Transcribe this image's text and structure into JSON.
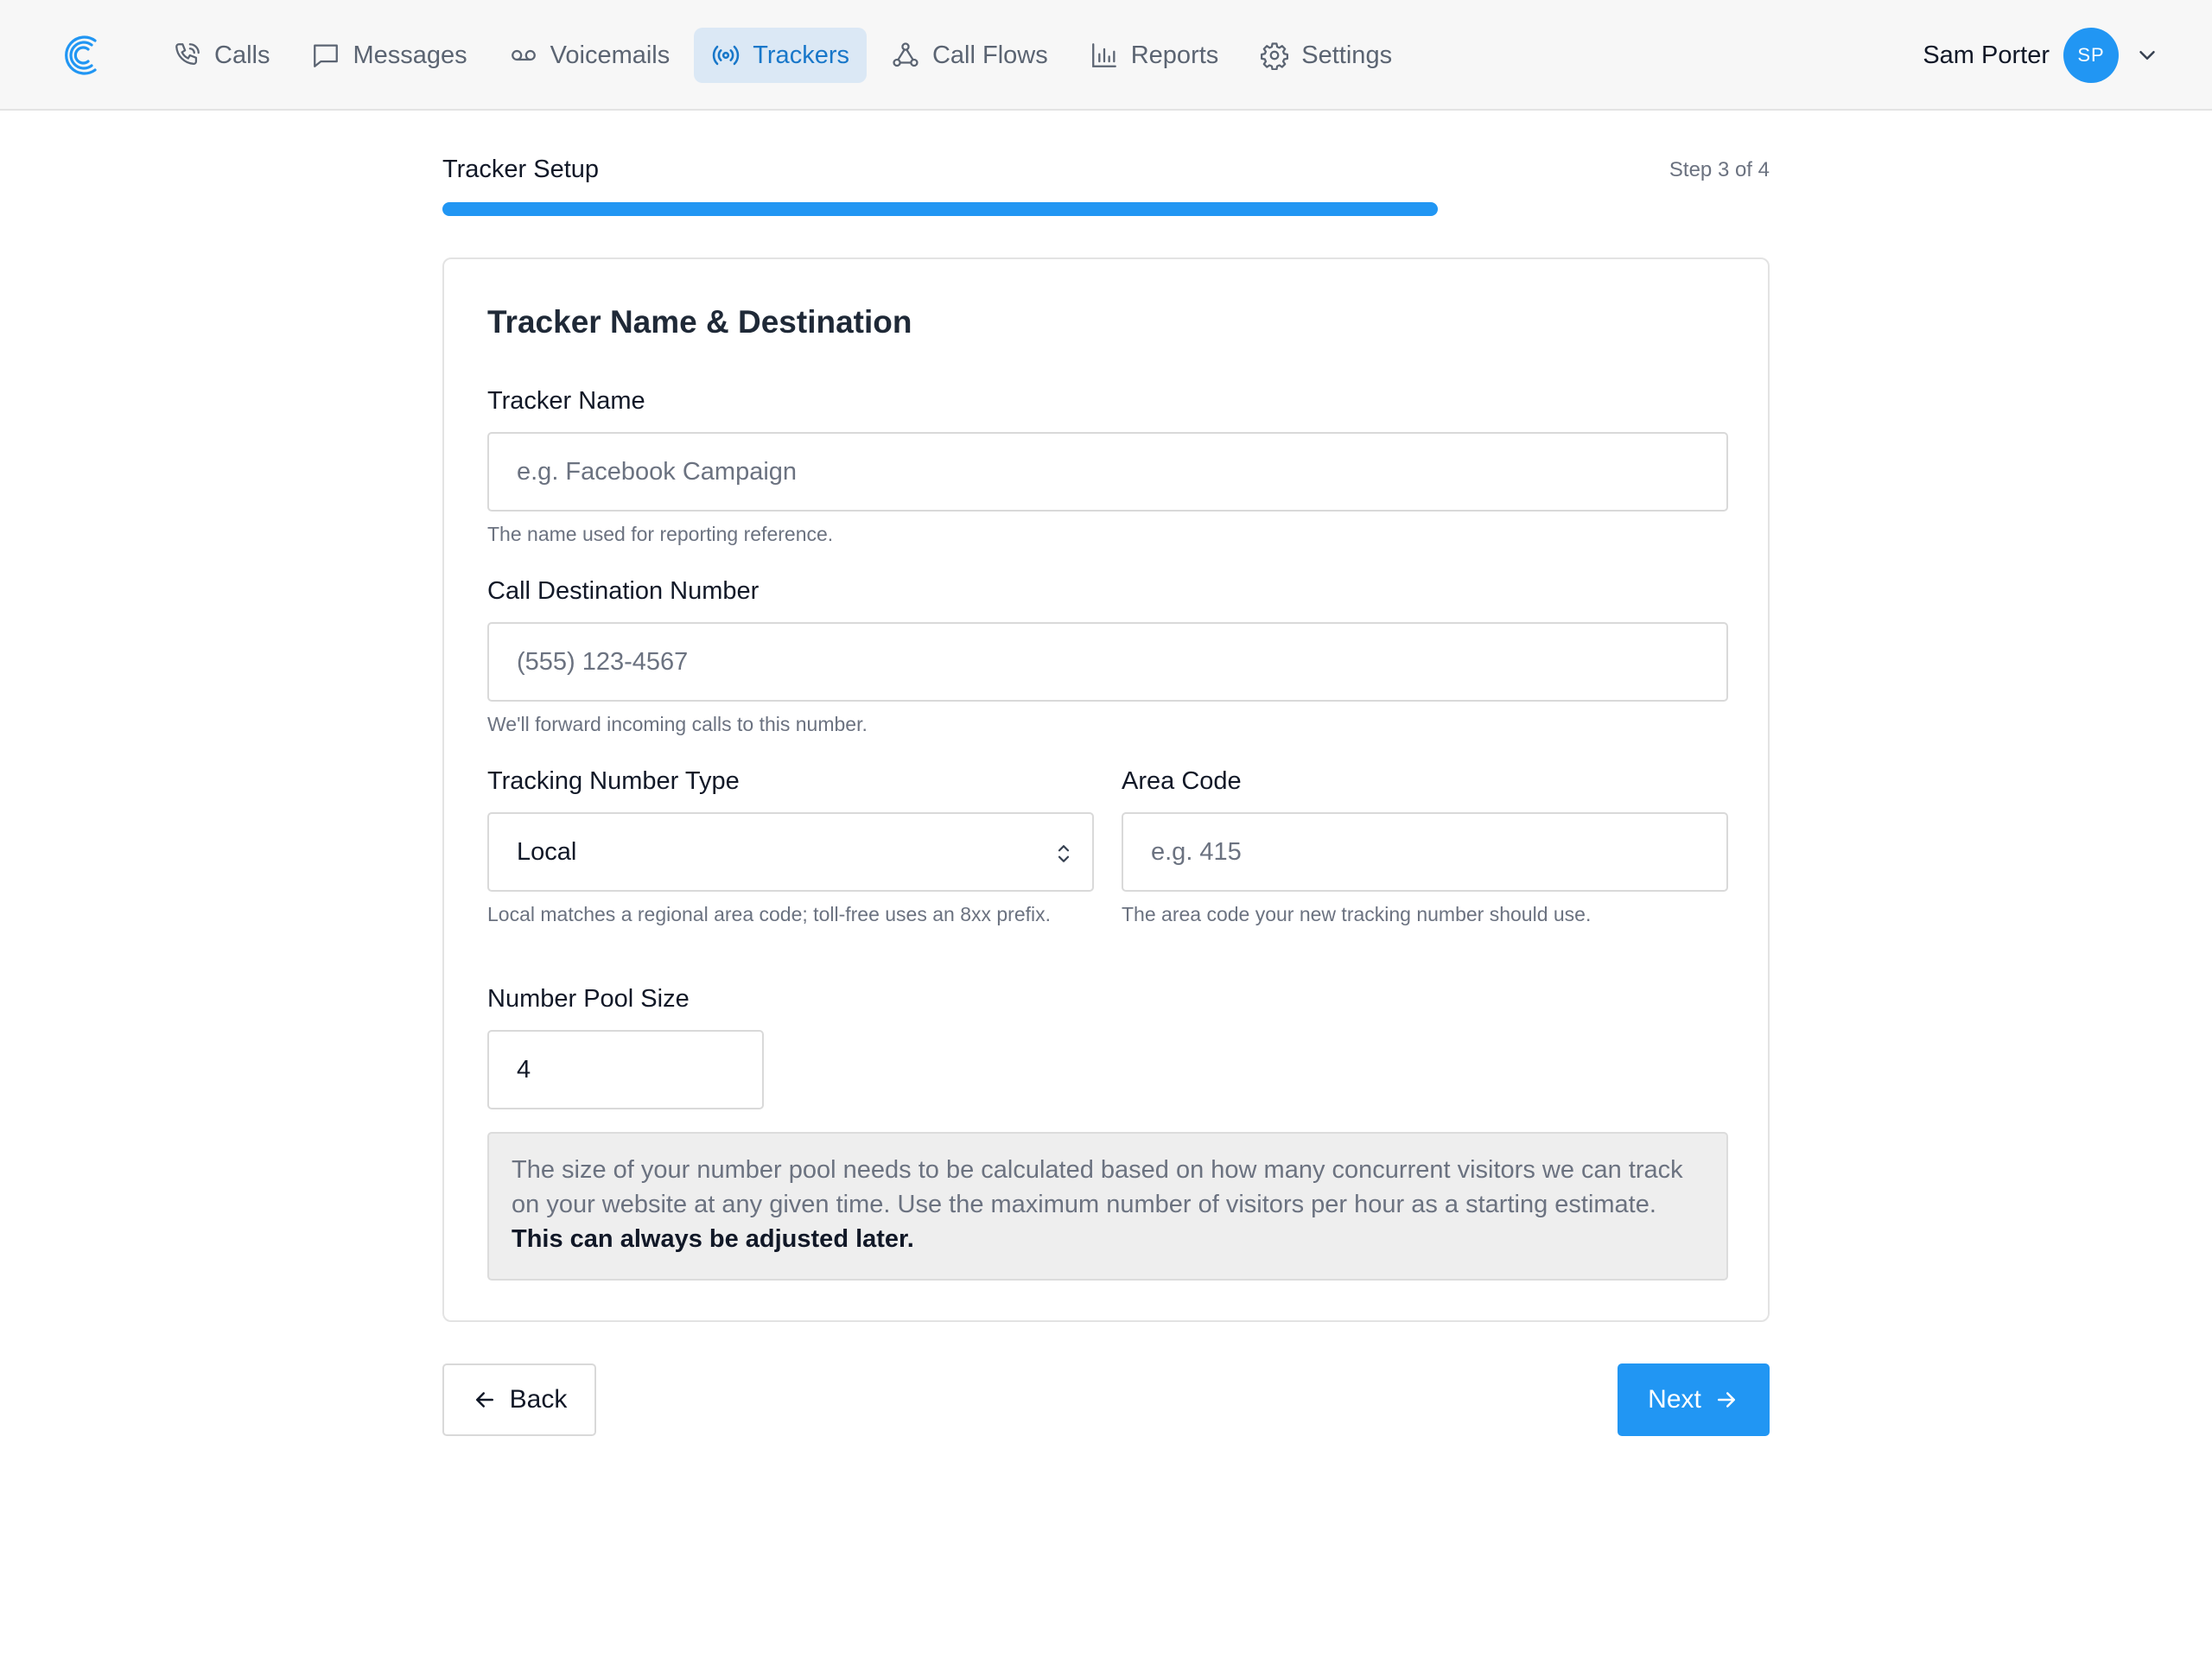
{
  "nav": {
    "items": [
      {
        "label": "Calls",
        "icon": "phone-icon"
      },
      {
        "label": "Messages",
        "icon": "message-icon"
      },
      {
        "label": "Voicemails",
        "icon": "voicemail-icon"
      },
      {
        "label": "Trackers",
        "icon": "broadcast-icon",
        "active": true
      },
      {
        "label": "Call Flows",
        "icon": "flow-icon"
      },
      {
        "label": "Reports",
        "icon": "bar-chart-icon"
      },
      {
        "label": "Settings",
        "icon": "gear-icon"
      }
    ]
  },
  "user": {
    "name": "Sam Porter",
    "initials": "SP"
  },
  "setup": {
    "title": "Tracker Setup",
    "step": "Step 3 of 4",
    "progress": 0.75
  },
  "card": {
    "title": "Tracker Name & Destination",
    "tracker_name": {
      "label": "Tracker Name",
      "placeholder": "e.g. Facebook Campaign",
      "help": "The name used for reporting reference."
    },
    "destination": {
      "label": "Call Destination Number",
      "placeholder": "(555) 123-4567",
      "help": "We'll forward incoming calls to this number."
    },
    "number_type": {
      "label": "Tracking Number Type",
      "value": "Local",
      "help": "Local matches a regional area code; toll-free uses an 8xx prefix."
    },
    "area_code": {
      "label": "Area Code",
      "placeholder": "e.g. 415",
      "help": "The area code your new tracking number should use."
    },
    "pool_size": {
      "label": "Number Pool Size",
      "value": "4"
    },
    "note": {
      "text": "The size of your number pool needs to be calculated based on how many concurrent visitors we can track on your website at any given time. Use the maximum number of visitors per hour as a starting estimate.",
      "emphasis": "This can always be adjusted later."
    }
  },
  "buttons": {
    "back": "Back",
    "next": "Next"
  },
  "colors": {
    "accent": "#2196f3",
    "active_nav_bg": "#dbe8f5",
    "active_nav_text": "#1877c9"
  }
}
